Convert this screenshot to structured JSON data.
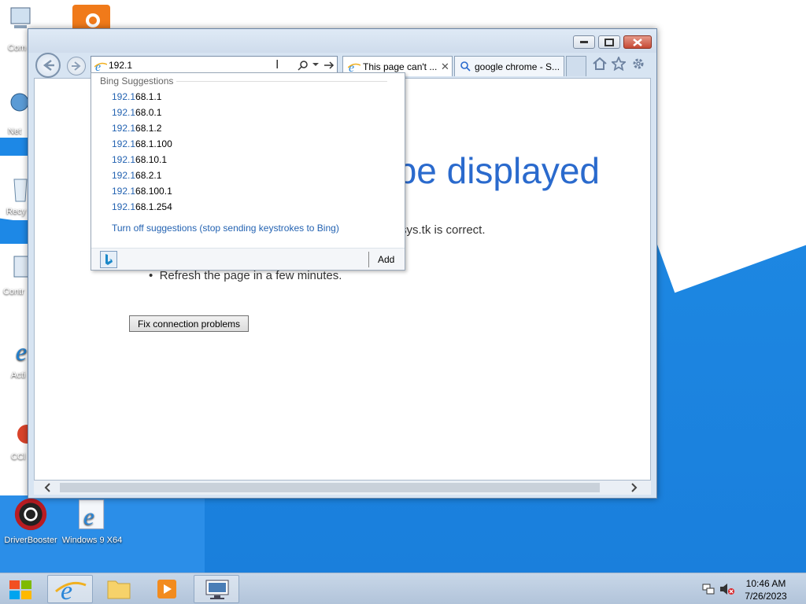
{
  "desktop": {
    "icons": [
      {
        "label": "Com"
      },
      {
        "label": "Net"
      },
      {
        "label": "Recy"
      },
      {
        "label": "Contr"
      },
      {
        "label": "Acti"
      },
      {
        "label": "CCl"
      },
      {
        "label": "DriverBooster"
      },
      {
        "label": "Windows 9 X64"
      }
    ]
  },
  "browser": {
    "address": {
      "value": "192.1"
    },
    "tabs": [
      {
        "label": "This page can't ...",
        "icon": "ie-icon"
      },
      {
        "label": "google chrome - S...",
        "icon": "search-icon"
      }
    ],
    "error": {
      "title_fragment": "be displayed",
      "text_fragment": "sys.tk is correct.",
      "bullet": "Refresh the page in a few minutes.",
      "fix_button": "Fix connection problems"
    },
    "suggestions": {
      "header": "Bing Suggestions",
      "typed": "192.1",
      "items": [
        {
          "rest": "68.1.1"
        },
        {
          "rest": "68.0.1"
        },
        {
          "rest": "68.1.2"
        },
        {
          "rest": "68.1.100"
        },
        {
          "rest": "68.10.1"
        },
        {
          "rest": "68.2.1"
        },
        {
          "rest": "68.100.1"
        },
        {
          "rest": "68.1.254"
        }
      ],
      "turn_off": "Turn off suggestions (stop sending keystrokes to Bing)",
      "add_label": "Add"
    }
  },
  "taskbar": {
    "clock_time": "10:46 AM",
    "clock_date": "7/26/2023"
  },
  "colors": {
    "accent": "#2a6acd",
    "desktop_blue": "#1a7fdc",
    "link": "#2463b2"
  }
}
